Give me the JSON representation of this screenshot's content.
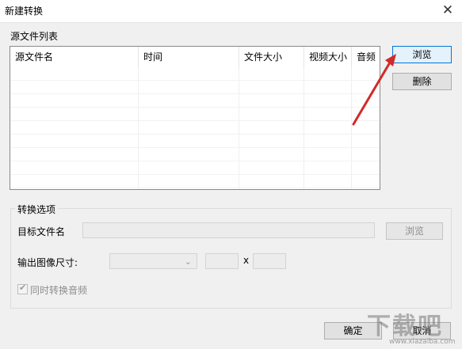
{
  "window": {
    "title": "新建转换",
    "close_glyph": "✕"
  },
  "source_list": {
    "label": "源文件列表",
    "columns": [
      "源文件名",
      "时间",
      "文件大小",
      "视频大小",
      "音频"
    ],
    "rows": []
  },
  "buttons": {
    "browse": "浏览",
    "delete": "删除",
    "browse_target": "浏览",
    "ok": "确定",
    "cancel": "取消"
  },
  "options": {
    "title": "转换选项",
    "target_label": "目标文件名",
    "target_value": "",
    "size_label": "输出图像尺寸:",
    "size_select_value": "",
    "width_value": "",
    "height_value": "",
    "size_separator": "x",
    "sync_audio_label": "同时转换音频",
    "sync_audio_checked": true
  },
  "watermark": {
    "text": "下载吧",
    "url_text": "www.xiazaiba.com"
  },
  "colors": {
    "annotation_arrow": "#d12a2a",
    "focus_border": "#0078d7"
  }
}
